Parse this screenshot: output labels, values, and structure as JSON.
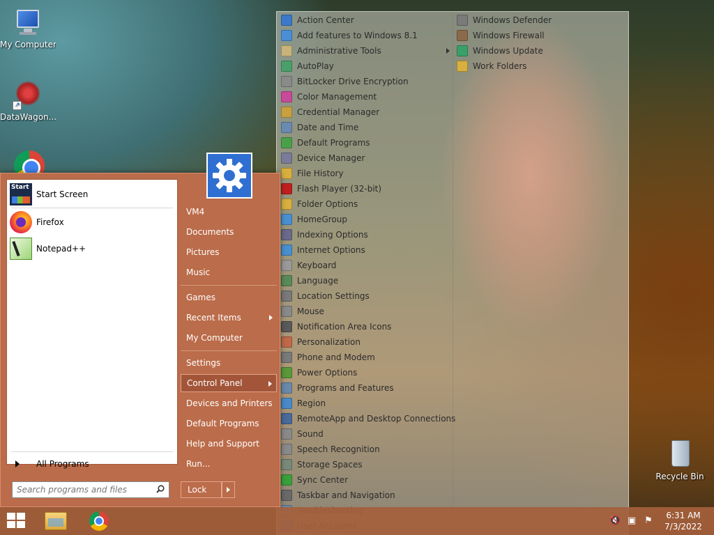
{
  "desktop": {
    "icons": [
      {
        "label": "My Computer"
      },
      {
        "label": "DataWagon..."
      },
      {
        "label": "Recycle Bin"
      }
    ]
  },
  "start_menu": {
    "programs": [
      {
        "label": "Start Screen",
        "icon": "start-screen-icon"
      },
      {
        "label": "Firefox",
        "icon": "firefox-icon"
      },
      {
        "label": "Notepad++",
        "icon": "notepad-plus-plus-icon"
      }
    ],
    "all_programs": "All Programs",
    "search_placeholder": "Search programs and files",
    "right_items": [
      {
        "label": "VM4"
      },
      {
        "label": "Documents"
      },
      {
        "label": "Pictures"
      },
      {
        "label": "Music"
      },
      {
        "label": "Games"
      },
      {
        "label": "Recent Items",
        "submenu": true
      },
      {
        "label": "My Computer"
      },
      {
        "label": "Settings"
      },
      {
        "label": "Control Panel",
        "submenu": true,
        "active": true
      },
      {
        "label": "Devices and Printers"
      },
      {
        "label": "Default Programs"
      },
      {
        "label": "Help and Support"
      },
      {
        "label": "Run..."
      }
    ],
    "lock_label": "Lock",
    "accent": "#bb6c4a",
    "avatar_color": "#2f6fd1"
  },
  "control_panel": {
    "col1": [
      {
        "label": "Action Center",
        "color": "#3b78c9"
      },
      {
        "label": "Add features to Windows 8.1",
        "color": "#4a8fd6"
      },
      {
        "label": "Administrative Tools",
        "color": "#c8b47a",
        "submenu": true
      },
      {
        "label": "AutoPlay",
        "color": "#4aa06a"
      },
      {
        "label": "BitLocker Drive Encryption",
        "color": "#8a8a8a"
      },
      {
        "label": "Color Management",
        "color": "#c84a9a"
      },
      {
        "label": "Credential Manager",
        "color": "#c8a040"
      },
      {
        "label": "Date and Time",
        "color": "#6a8ab0"
      },
      {
        "label": "Default Programs",
        "color": "#4aa04a"
      },
      {
        "label": "Device Manager",
        "color": "#7a7a9a"
      },
      {
        "label": "File History",
        "color": "#d8b040"
      },
      {
        "label": "Flash Player (32-bit)",
        "color": "#c02020"
      },
      {
        "label": "Folder Options",
        "color": "#d8b040"
      },
      {
        "label": "HomeGroup",
        "color": "#4a90d0"
      },
      {
        "label": "Indexing Options",
        "color": "#6a6a8a"
      },
      {
        "label": "Internet Options",
        "color": "#4a90d0"
      },
      {
        "label": "Keyboard",
        "color": "#9a9a9a"
      },
      {
        "label": "Language",
        "color": "#5a8a5a"
      },
      {
        "label": "Location Settings",
        "color": "#7a7a7a"
      },
      {
        "label": "Mouse",
        "color": "#8a8a8a"
      },
      {
        "label": "Notification Area Icons",
        "color": "#5a5a5a"
      },
      {
        "label": "Personalization",
        "color": "#c06a4a"
      },
      {
        "label": "Phone and Modem",
        "color": "#7a7a7a"
      },
      {
        "label": "Power Options",
        "color": "#5a9a3a"
      },
      {
        "label": "Programs and Features",
        "color": "#6a8aaa"
      },
      {
        "label": "Region",
        "color": "#4a8aca"
      },
      {
        "label": "RemoteApp and Desktop Connections",
        "color": "#4a6a9a"
      },
      {
        "label": "Sound",
        "color": "#8a8a8a"
      },
      {
        "label": "Speech Recognition",
        "color": "#8a8a8a"
      },
      {
        "label": "Storage Spaces",
        "color": "#7a8a7a"
      },
      {
        "label": "Sync Center",
        "color": "#3aa03a"
      },
      {
        "label": "Taskbar and Navigation",
        "color": "#6a6a6a"
      },
      {
        "label": "Troubleshooting",
        "color": "#6a8aaa"
      },
      {
        "label": "User Accounts",
        "color": "#5a7aaa"
      }
    ],
    "col2": [
      {
        "label": "Windows Defender",
        "color": "#7a7a7a"
      },
      {
        "label": "Windows Firewall",
        "color": "#8a6a4a"
      },
      {
        "label": "Windows Update",
        "color": "#3aa06a"
      },
      {
        "label": "Work Folders",
        "color": "#d8b040"
      }
    ]
  },
  "taskbar": {
    "time": "6:31 AM",
    "date": "7/3/2022"
  }
}
